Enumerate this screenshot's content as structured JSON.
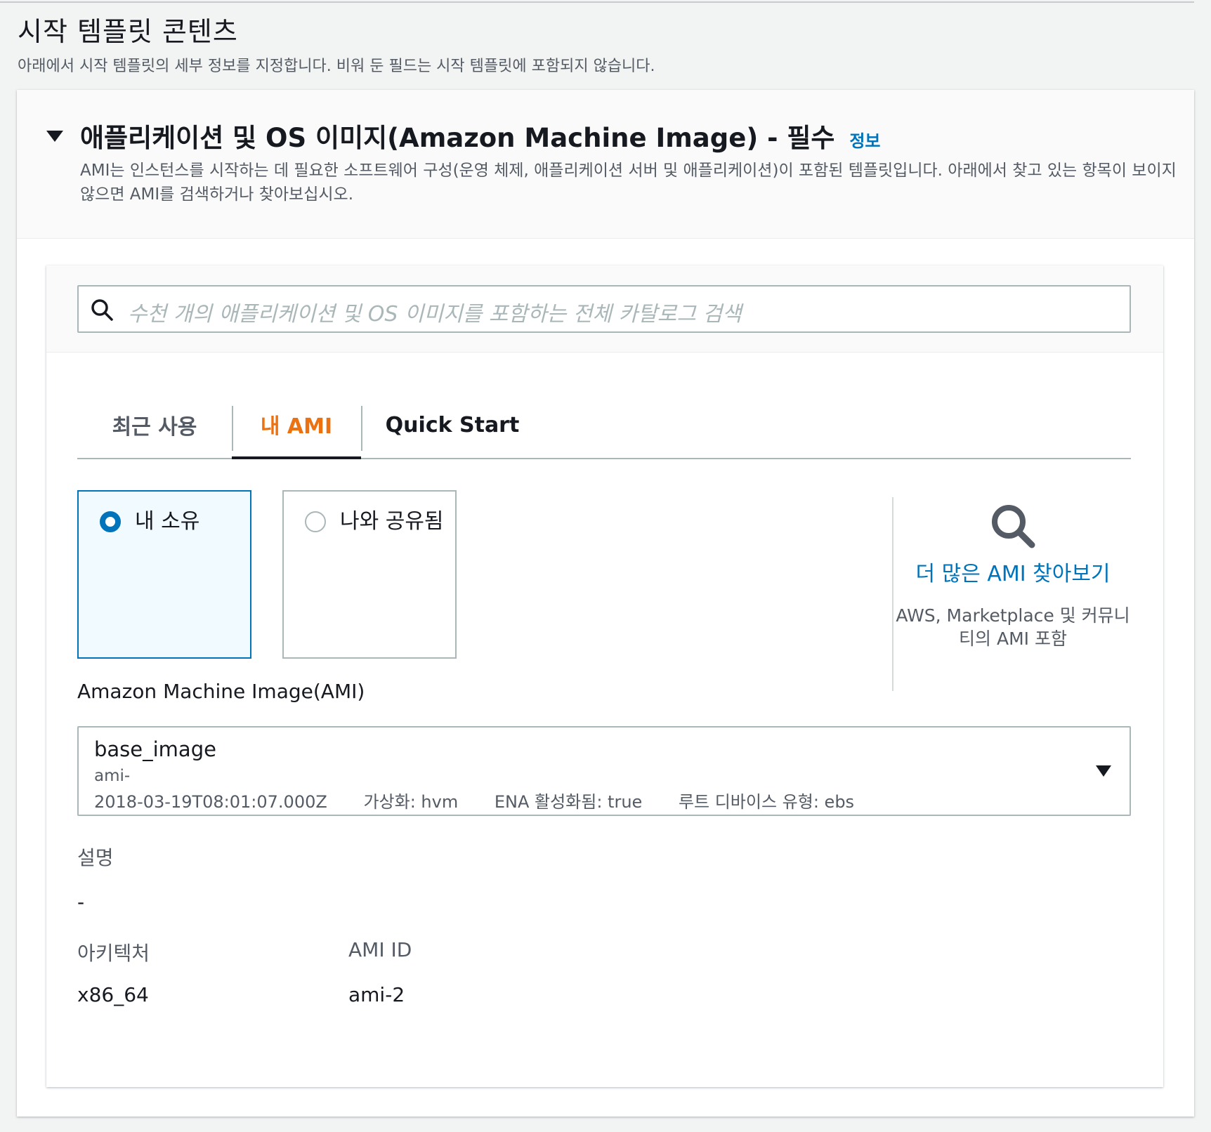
{
  "page": {
    "title": "시작 템플릿 콘텐츠",
    "description": "아래에서 시작 템플릿의 세부 정보를 지정합니다. 비워 둔 필드는 시작 템플릿에 포함되지 않습니다."
  },
  "section": {
    "title": "애플리케이션 및 OS 이미지(Amazon Machine Image) - 필수",
    "info_link": "정보",
    "description": "AMI는 인스턴스를 시작하는 데 필요한 소프트웨어 구성(운영 체제, 애플리케이션 서버 및 애플리케이션)이 포함된 템플릿입니다. 아래에서 찾고 있는 항목이 보이지 않으면 AMI를 검색하거나 찾아보십시오."
  },
  "search": {
    "placeholder": "수천 개의 애플리케이션 및 OS 이미지를 포함하는 전체 카탈로그 검색"
  },
  "tabs": [
    {
      "label": "최근 사용",
      "active": false
    },
    {
      "label": "내 AMI",
      "active": true
    },
    {
      "label": "Quick Start",
      "active": false
    }
  ],
  "ownership": {
    "options": [
      {
        "label": "내 소유",
        "selected": true
      },
      {
        "label": "나와 공유됨",
        "selected": false
      }
    ]
  },
  "browse": {
    "link": "더 많은 AMI 찾아보기",
    "note": "AWS, Marketplace 및 커뮤니티의 AMI 포함"
  },
  "ami": {
    "label": "Amazon Machine Image(AMI)",
    "name": "base_image",
    "id_prefix": "ami-",
    "created": "2018-03-19T08:01:07.000Z",
    "virtualization": "가상화: hvm",
    "ena": "ENA 활성화됨: true",
    "root_device": "루트 디바이스 유형: ebs"
  },
  "details": {
    "description_label": "설명",
    "description_value": "-",
    "architecture_label": "아키텍처",
    "architecture_value": "x86_64",
    "ami_id_label": "AMI ID",
    "ami_id_value": "ami-2"
  },
  "colors": {
    "accent_blue": "#0073bb",
    "active_tab_orange": "#ec7211",
    "text_primary": "#16191f",
    "text_secondary": "#545b64"
  },
  "icons": [
    "collapse-caret-icon",
    "search-icon",
    "radio-icon",
    "browse-search-icon",
    "dropdown-caret-icon"
  ]
}
